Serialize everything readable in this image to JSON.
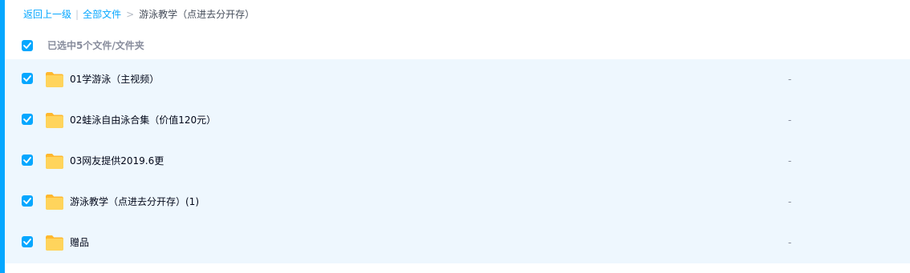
{
  "breadcrumb": {
    "back": "返回上一级",
    "separator": "|",
    "all_files": "全部文件",
    "arrow": ">",
    "current": "游泳教学（点进去分开存）"
  },
  "selection": {
    "summary": "已选中5个文件/文件夹",
    "all_checked": true
  },
  "files": [
    {
      "name": "01学游泳（主视频）",
      "meta": "-",
      "checked": true,
      "icon": "folder-icon"
    },
    {
      "name": "02蛙泳自由泳合集（价值120元）",
      "meta": "-",
      "checked": true,
      "icon": "folder-icon"
    },
    {
      "name": "03网友提供2019.6更",
      "meta": "-",
      "checked": true,
      "icon": "folder-icon"
    },
    {
      "name": "游泳教学（点进去分开存）(1)",
      "meta": "-",
      "checked": true,
      "icon": "folder-icon"
    },
    {
      "name": "赠品",
      "meta": "-",
      "checked": true,
      "icon": "folder-icon"
    }
  ],
  "colors": {
    "accent": "#06a7ff",
    "row_selected_bg": "#eef7fe",
    "folder": "#ffc94a"
  }
}
